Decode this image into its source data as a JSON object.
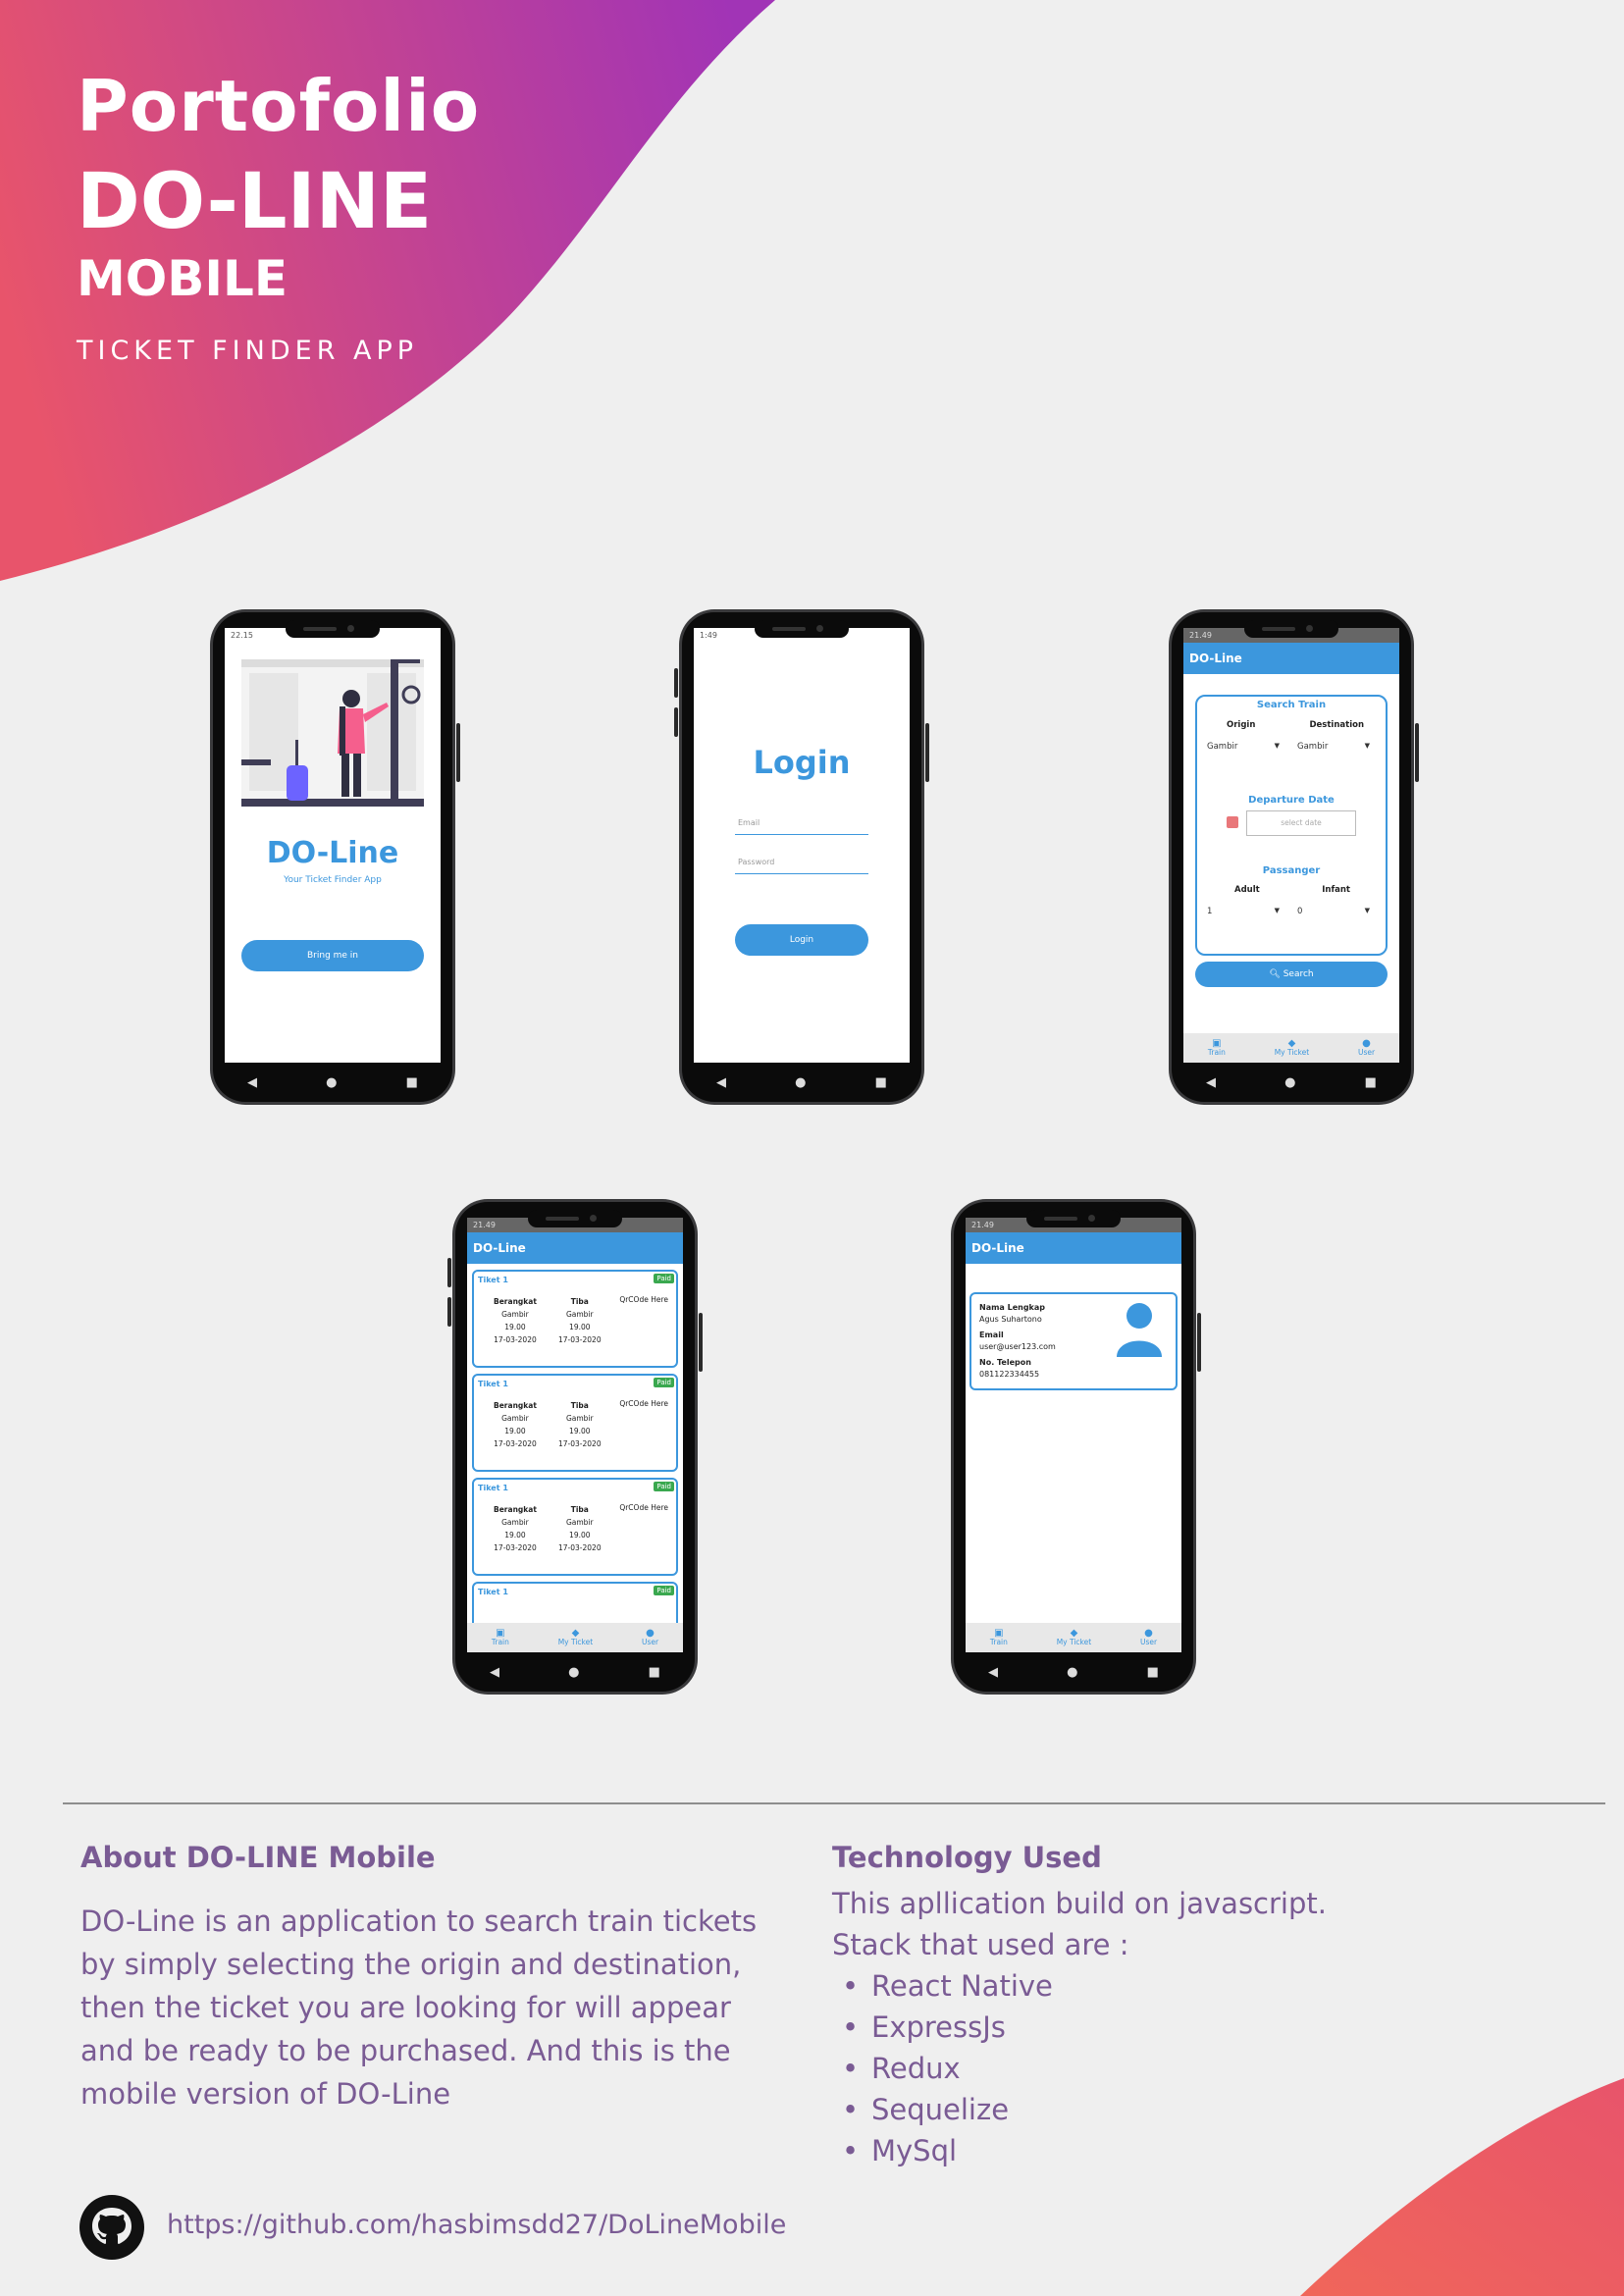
{
  "header": {
    "title_line1": "Portofolio",
    "title_line2": "DO-LINE",
    "title_line3": "MOBILE",
    "subtitle": "TICKET FINDER APP"
  },
  "colors": {
    "gradient_start": "#e8546b",
    "gradient_end": "#a134b6",
    "corner_gradient": "#f0665a",
    "accent_blue": "#3c97dd",
    "text_purple": "#7a5b94",
    "paid_green": "#3aa84f"
  },
  "phone_splash": {
    "status_time": "22.15",
    "app_name": "DO-Line",
    "tagline": "Your Ticket Finder App",
    "button_label": "Bring me in"
  },
  "phone_login": {
    "status_time": "1:49",
    "title": "Login",
    "email_placeholder": "Email",
    "password_placeholder": "Password",
    "button_label": "Login"
  },
  "phone_search": {
    "status_time": "21.49",
    "appbar_title": "DO-Line",
    "section_search": "Search Train",
    "origin_label": "Origin",
    "destination_label": "Destination",
    "origin_value": "Gambir",
    "destination_value": "Gambir",
    "section_departure": "Departure Date",
    "date_placeholder": "select date",
    "section_passenger": "Passanger",
    "adult_label": "Adult",
    "infant_label": "Infant",
    "adult_value": "1",
    "infant_value": "0",
    "search_button": "Search"
  },
  "phone_tickets": {
    "status_time": "21.49",
    "appbar_title": "DO-Line",
    "tickets": [
      {
        "label": "Tiket 1",
        "status": "Paid",
        "depart_header": "Berangkat",
        "arrive_header": "Tiba",
        "depart_station": "Gambir",
        "arrive_station": "Gambir",
        "depart_time": "19.00",
        "arrive_time": "19.00",
        "depart_date": "17-03-2020",
        "arrive_date": "17-03-2020",
        "qr": "QrCOde Here"
      },
      {
        "label": "Tiket 1",
        "status": "Paid",
        "depart_header": "Berangkat",
        "arrive_header": "Tiba",
        "depart_station": "Gambir",
        "arrive_station": "Gambir",
        "depart_time": "19.00",
        "arrive_time": "19.00",
        "depart_date": "17-03-2020",
        "arrive_date": "17-03-2020",
        "qr": "QrCOde Here"
      },
      {
        "label": "Tiket 1",
        "status": "Paid",
        "depart_header": "Berangkat",
        "arrive_header": "Tiba",
        "depart_station": "Gambir",
        "arrive_station": "Gambir",
        "depart_time": "19.00",
        "arrive_time": "19.00",
        "depart_date": "17-03-2020",
        "arrive_date": "17-03-2020",
        "qr": "QrCOde Here"
      }
    ],
    "partial_ticket_label": "Tiket 1",
    "partial_ticket_status": "Paid"
  },
  "phone_user": {
    "status_time": "21.49",
    "appbar_title": "DO-Line",
    "name_label": "Nama Lengkap",
    "name_value": "Agus Suhartono",
    "email_label": "Email",
    "email_value": "user@user123.com",
    "phone_label": "No. Telepon",
    "phone_value": "081122334455"
  },
  "tabbar": {
    "train": "Train",
    "my_ticket": "My Ticket",
    "user": "User"
  },
  "about": {
    "heading": "About DO-LINE Mobile",
    "body": "DO-Line is an application to search  train tickets by simply selecting the origin and destination, then the ticket you are looking for will appear and be ready to be purchased. And this is the mobile version of DO-Line"
  },
  "technology": {
    "heading": "Technology Used",
    "line1": "This apllication build on javascript.",
    "line2": "Stack that used are :",
    "stack": [
      "React Native",
      "ExpressJs",
      "Redux",
      "Sequelize",
      "MySql"
    ]
  },
  "footer": {
    "github_url": "https://github.com/hasbimsdd27/DoLineMobile"
  }
}
